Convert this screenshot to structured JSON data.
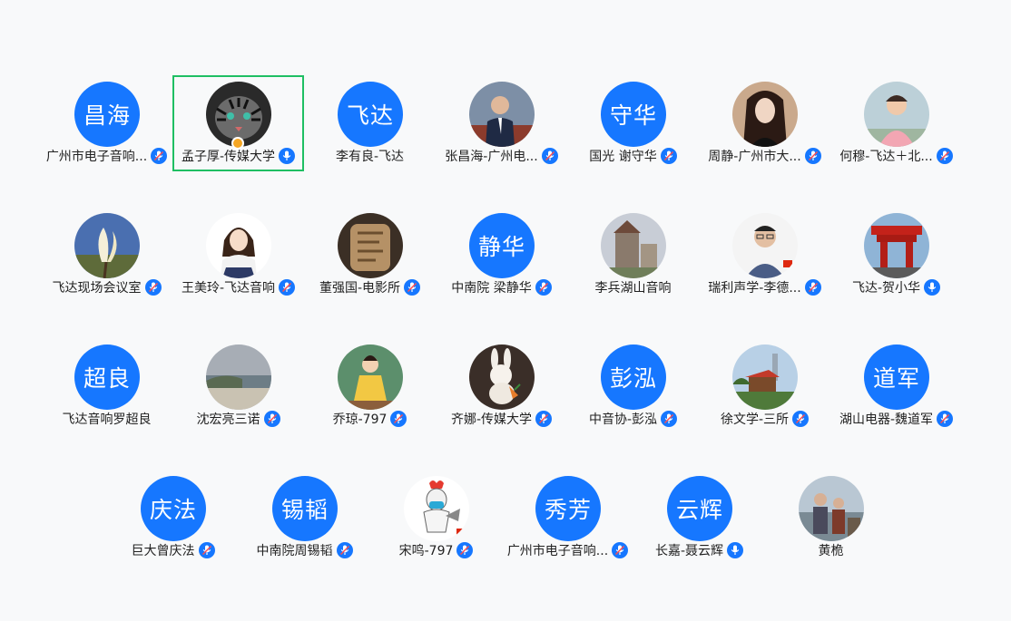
{
  "participants": [
    {
      "name": "广州市电子音响...",
      "avatar_text": "昌海",
      "mic": "muted"
    },
    {
      "name": "孟子厚-传媒大学",
      "avatar_icon": "tiger-photo-icon",
      "mic": "on",
      "selected": true,
      "host": true
    },
    {
      "name": "李有良-飞达",
      "avatar_text": "飞达",
      "mic": "none"
    },
    {
      "name": "张昌海-广州电...",
      "avatar_icon": "man-in-suit-photo-icon",
      "mic": "muted"
    },
    {
      "name": "国光  谢守华",
      "avatar_text": "守华",
      "mic": "muted"
    },
    {
      "name": "周静-广州市大...",
      "avatar_icon": "woman-portrait-photo-icon",
      "mic": "muted"
    },
    {
      "name": "何穆-飞达＋北...",
      "avatar_icon": "woman-pink-shirt-photo-icon",
      "mic": "muted"
    },
    {
      "name": "飞达现场会议室",
      "avatar_icon": "magnolia-flower-photo-icon",
      "mic": "muted"
    },
    {
      "name": "王美玲-飞达音响",
      "avatar_icon": "cartoon-girl-photo-icon",
      "mic": "muted"
    },
    {
      "name": "董强国-电影所",
      "avatar_icon": "carved-stone-photo-icon",
      "mic": "muted"
    },
    {
      "name": "中南院  梁静华",
      "avatar_text": "静华",
      "mic": "muted"
    },
    {
      "name": "李兵湖山音响",
      "avatar_icon": "castle-photo-icon",
      "mic": "none"
    },
    {
      "name": "瑞利声学-李德...",
      "avatar_icon": "man-glasses-photo-icon",
      "mic": "muted"
    },
    {
      "name": "飞达-贺小华",
      "avatar_icon": "red-pavilion-photo-icon",
      "mic": "on"
    },
    {
      "name": "飞达音响罗超良",
      "avatar_text": "超良",
      "mic": "none"
    },
    {
      "name": "沈宏亮三诺",
      "avatar_icon": "seaside-photo-icon",
      "mic": "muted"
    },
    {
      "name": "乔琼-797",
      "avatar_icon": "girl-yellow-dress-photo-icon",
      "mic": "muted"
    },
    {
      "name": "齐娜-传媒大学",
      "avatar_icon": "white-rabbit-photo-icon",
      "mic": "muted"
    },
    {
      "name": "中音协-彭泓",
      "avatar_text": "彭泓",
      "mic": "muted"
    },
    {
      "name": "徐文学-三所",
      "avatar_icon": "garden-pavilion-photo-icon",
      "mic": "muted"
    },
    {
      "name": "湖山电器-魏道军",
      "avatar_text": "道军",
      "mic": "muted"
    },
    {
      "name": "巨大曾庆法",
      "avatar_text": "庆法",
      "mic": "muted"
    },
    {
      "name": "中南院周锡韬",
      "avatar_text": "锡韬",
      "mic": "muted"
    },
    {
      "name": "宋鸣-797",
      "avatar_icon": "cartoon-rooster-photo-icon",
      "mic": "muted"
    },
    {
      "name": "广州市电子音响...",
      "avatar_text": "秀芳",
      "mic": "muted"
    },
    {
      "name": "长嘉-聂云辉",
      "avatar_text": "云辉",
      "mic": "on"
    },
    {
      "name": "黄桅",
      "avatar_icon": "couple-by-sea-photo-icon",
      "mic": "none"
    }
  ],
  "colors": {
    "avatar_blue": "#1677ff",
    "mic_blue": "#1677ff",
    "selected_border": "#1fbf63",
    "host_badge": "#f5a623",
    "background": "#f8f9fa"
  }
}
